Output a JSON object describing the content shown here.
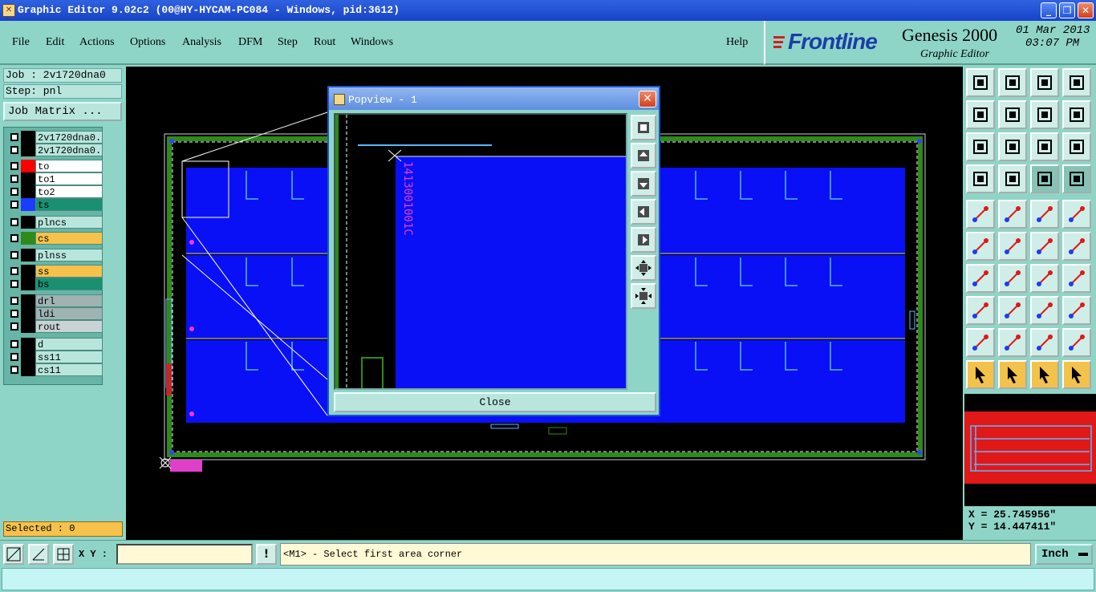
{
  "window": {
    "title": "Graphic Editor 9.02c2 (00@HY-HYCAM-PC084 - Windows, pid:3612)",
    "min": "_",
    "max": "❐",
    "close": "✕"
  },
  "menu": {
    "items": [
      "File",
      "Edit",
      "Actions",
      "Options",
      "Analysis",
      "DFM",
      "Step",
      "Rout",
      "Windows"
    ],
    "help": "Help"
  },
  "brand": {
    "logo": "Frontline",
    "product": "Genesis 2000",
    "subtitle": "Graphic Editor",
    "date": "01 Mar 2013",
    "time": "03:07 PM"
  },
  "left": {
    "job": "Job : 2v1720dna0",
    "step": "Step: pnl",
    "job_matrix": "Job Matrix ...",
    "selected": "Selected : 0",
    "layers": [
      {
        "name": "2v1720dna0.",
        "swatch": "#000000",
        "bg": "#b9e6dc"
      },
      {
        "name": "2v1720dna0.",
        "swatch": "#000000",
        "bg": "#b9e6dc"
      },
      {
        "name": "to",
        "swatch": "#ff0000",
        "bg": "#ffffff"
      },
      {
        "name": "to1",
        "swatch": "#000000",
        "bg": "#ffffff"
      },
      {
        "name": "to2",
        "swatch": "#000000",
        "bg": "#ffffff"
      },
      {
        "name": "ts",
        "swatch": "#1a3cff",
        "bg": "#1b8f72"
      },
      {
        "name": "plncs",
        "swatch": "#000000",
        "bg": "#b9e6dc"
      },
      {
        "name": "cs",
        "swatch": "#2e8b1a",
        "bg": "#f6c24b"
      },
      {
        "name": "plnss",
        "swatch": "#000000",
        "bg": "#b9e6dc"
      },
      {
        "name": "ss",
        "swatch": "#000000",
        "bg": "#f6c24b"
      },
      {
        "name": "bs",
        "swatch": "#000000",
        "bg": "#1b8f72"
      },
      {
        "name": "drl",
        "swatch": "#000000",
        "bg": "#9fb3b3"
      },
      {
        "name": "ldi",
        "swatch": "#000000",
        "bg": "#9fb3b3"
      },
      {
        "name": "rout",
        "swatch": "#000000",
        "bg": "#c9d3d3"
      },
      {
        "name": "d",
        "swatch": "#000000",
        "bg": "#b9e6dc"
      },
      {
        "name": "ss11",
        "swatch": "#000000",
        "bg": "#b9e6dc"
      },
      {
        "name": "cs11",
        "swatch": "#000000",
        "bg": "#b9e6dc"
      }
    ]
  },
  "right": {
    "x": "X = 25.745956\"",
    "y": "Y = 14.447411\""
  },
  "status": {
    "xy_label": "X Y :",
    "xy_value": "",
    "prompt": "<M1> - Select first area corner",
    "unit": "Inch",
    "alert_icon": "!"
  },
  "popview": {
    "title": "Popview - 1",
    "close_x": "✕",
    "close_label": "Close",
    "text_label": "1413001001C"
  }
}
